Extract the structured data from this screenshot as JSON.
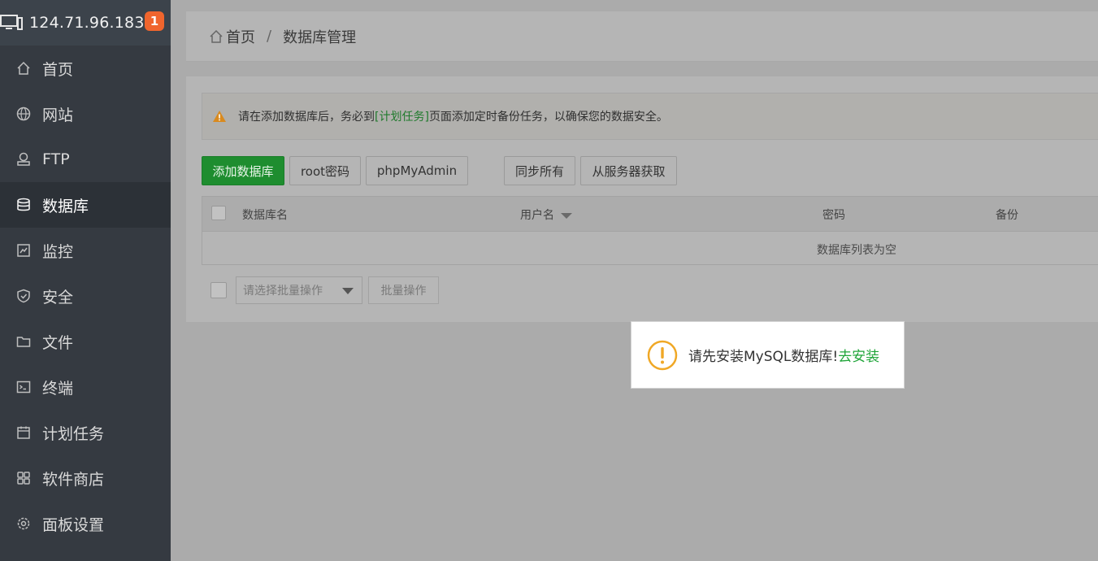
{
  "sidebar": {
    "server_ip": "124.71.96.183",
    "notification_count": "1",
    "items": [
      {
        "label": "首页",
        "icon": "home-icon"
      },
      {
        "label": "网站",
        "icon": "globe-icon"
      },
      {
        "label": "FTP",
        "icon": "ftp-icon"
      },
      {
        "label": "数据库",
        "icon": "database-icon",
        "active": true
      },
      {
        "label": "监控",
        "icon": "monitor-icon"
      },
      {
        "label": "安全",
        "icon": "shield-icon"
      },
      {
        "label": "文件",
        "icon": "folder-icon"
      },
      {
        "label": "终端",
        "icon": "terminal-icon"
      },
      {
        "label": "计划任务",
        "icon": "calendar-icon"
      },
      {
        "label": "软件商店",
        "icon": "apps-icon"
      },
      {
        "label": "面板设置",
        "icon": "gear-icon"
      }
    ]
  },
  "breadcrumb": {
    "home": "首页",
    "separator": "/",
    "current": "数据库管理"
  },
  "alert": {
    "text_before": "请在添加数据库后，务必到",
    "link": "[计划任务]",
    "text_after": "页面添加定时备份任务，以确保您的数据安全。"
  },
  "toolbar": {
    "add_db": "添加数据库",
    "root_password": "root密码",
    "phpmyadmin": "phpMyAdmin",
    "sync_all": "同步所有",
    "fetch_from_server": "从服务器获取"
  },
  "table": {
    "columns": [
      "数据库名",
      "用户名",
      "密码",
      "备份"
    ],
    "empty_text": "数据库列表为空"
  },
  "batch": {
    "select_placeholder": "请选择批量操作",
    "action_button": "批量操作"
  },
  "toast": {
    "message": "请先安装MySQL数据库!",
    "action": "去安装"
  },
  "colors": {
    "sidebar_bg": "#353a41",
    "accent_green": "#20a53a",
    "badge_orange": "#f0652d",
    "warn_orange": "#e8a33d"
  }
}
